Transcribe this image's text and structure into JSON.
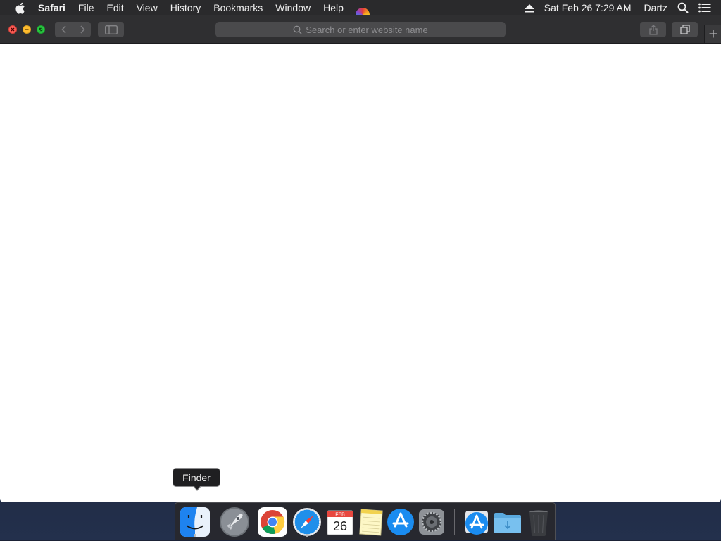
{
  "menubar": {
    "apple_icon": "apple-logo-icon",
    "app_name": "Safari",
    "items": [
      "File",
      "Edit",
      "View",
      "History",
      "Bookmarks",
      "Window",
      "Help"
    ],
    "clock": "Sat Feb 26  7:29 AM",
    "user": "Dartz",
    "icons": [
      "eject-icon",
      "spotlight-search-icon",
      "notification-center-icon"
    ]
  },
  "toolbar": {
    "url_placeholder": "Search or enter website name",
    "buttons": [
      "back",
      "forward",
      "show-sidebar",
      "share",
      "show-all-tabs",
      "new-tab"
    ]
  },
  "dock": {
    "tooltip": "Finder",
    "calendar_month": "FEB",
    "calendar_day": "26",
    "apps": [
      "Finder",
      "Launchpad",
      "Google Chrome",
      "Safari",
      "Calendar",
      "Notes",
      "App Store",
      "System Preferences",
      "Downloads",
      "Documents",
      "Trash"
    ],
    "running": [
      "Finder",
      "Safari"
    ]
  },
  "colors": {
    "menubar_bg": "#2a2a2c",
    "toolbar_bg": "#2f2f31",
    "close": "#ff5f57",
    "minimize": "#febc2e",
    "maximize": "#28c840"
  }
}
